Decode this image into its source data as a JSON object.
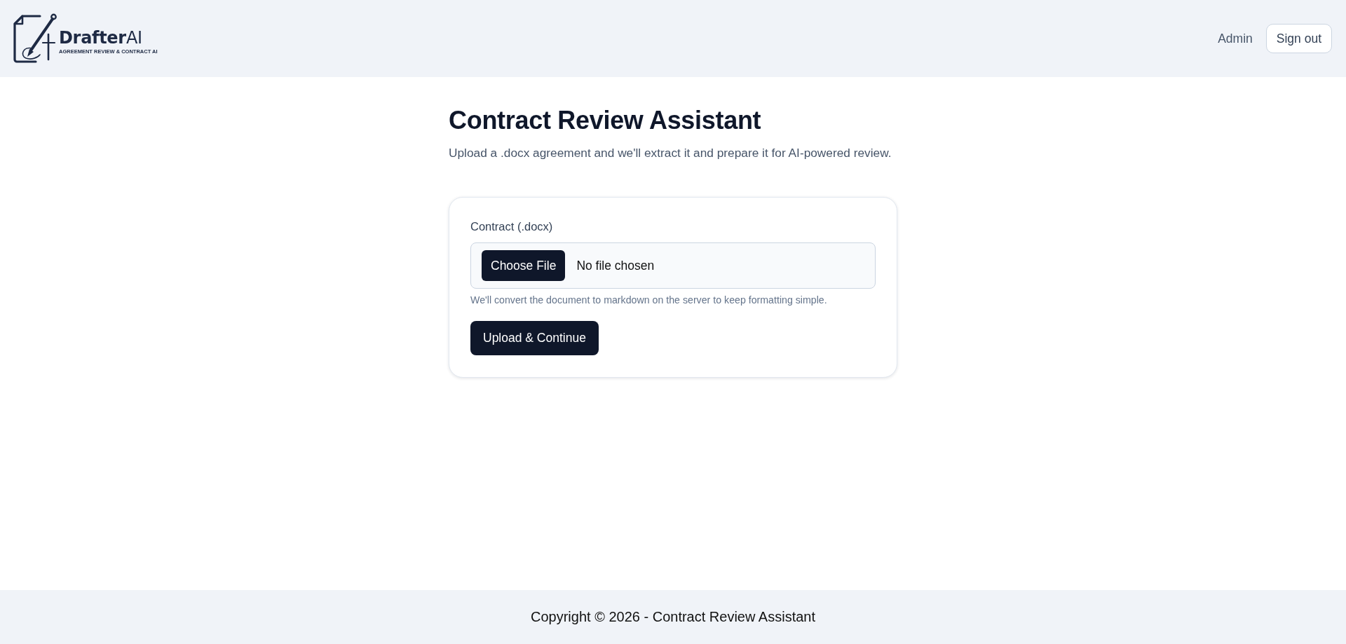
{
  "header": {
    "logo": {
      "name": "**Drafter**AI",
      "tagline": "AGREEMENT REVIEW & CONTRACT AI"
    },
    "user": "Admin",
    "sign_out": "Sign out"
  },
  "page": {
    "title": "Contract Review Assistant",
    "subtitle": "Upload a .docx agreement and we'll extract it and prepare it for AI-powered review."
  },
  "form": {
    "label": "Contract (.docx)",
    "file_input": {
      "button": "Choose File",
      "value": "No file chosen"
    },
    "hint": "We'll convert the document to markdown on the server to keep formatting simple.",
    "submit": "Upload & Continue"
  },
  "footer": {
    "text": "Copyright © 2026 - Contract Review Assistant"
  }
}
